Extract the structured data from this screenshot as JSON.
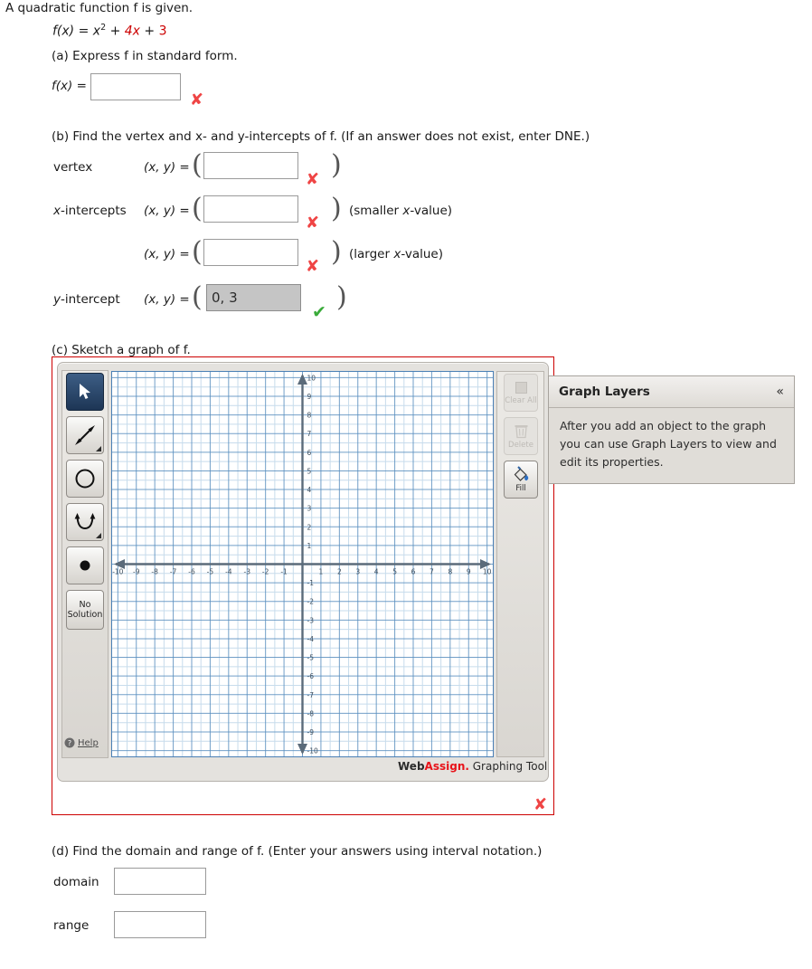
{
  "problem": {
    "intro": "A quadratic function f is given.",
    "function": {
      "lhs": "f(x) = ",
      "term1": "x",
      "exponent": "2",
      "plus1": " + ",
      "term2": "4x",
      "plus2": " + ",
      "term3": "3"
    }
  },
  "part_a": {
    "label": "(a) Express f in standard form.",
    "fx_label": "f(x) = ",
    "input_value": "",
    "mark": "✘"
  },
  "part_b": {
    "label": "(b) Find the vertex and x- and y-intercepts of f. (If an answer does not exist, enter DNE.)",
    "xy_equals": "(x, y) = ",
    "paren_open": "(",
    "paren_close": ")",
    "mark_wrong": "✘",
    "mark_correct": "✔",
    "rows": [
      {
        "label": "vertex",
        "value": "",
        "note": "",
        "status": "wrong"
      },
      {
        "label": "x-intercepts",
        "value": "",
        "note": "(smaller x-value)",
        "status": "wrong"
      },
      {
        "label": "",
        "value": "",
        "note": "(larger x-value)",
        "status": "wrong"
      },
      {
        "label": "y-intercept",
        "value": "0, 3",
        "note": "",
        "status": "correct"
      }
    ]
  },
  "part_c": {
    "label": "(c) Sketch a graph of f.",
    "mark": "✘",
    "graphing_tool": {
      "left_tools": [
        {
          "name": "select-tool",
          "label": "",
          "selected": true
        },
        {
          "name": "line-tool",
          "label": "",
          "selected": false
        },
        {
          "name": "circle-tool",
          "label": "",
          "selected": false
        },
        {
          "name": "parabola-tool",
          "label": "",
          "selected": false
        },
        {
          "name": "point-tool",
          "label": "",
          "selected": false
        },
        {
          "name": "no-solution-tool",
          "label_line1": "No",
          "label_line2": "Solution",
          "selected": false
        }
      ],
      "help_label": "Help",
      "right_tools": [
        {
          "name": "clear-all-button",
          "label": "Clear All",
          "disabled": true
        },
        {
          "name": "delete-button",
          "label": "Delete",
          "disabled": true
        },
        {
          "name": "fill-button",
          "label": "Fill",
          "disabled": false
        }
      ],
      "footer": {
        "web": "Web",
        "assign": "Assign.",
        "rest": " Graphing Tool"
      },
      "layers_panel": {
        "title": "Graph Layers",
        "collapse_icon": "«",
        "body": "After you add an object to the graph you can use Graph Layers to view and edit its properties."
      }
    }
  },
  "chart_data": {
    "type": "scatter",
    "title": "",
    "xlabel": "",
    "ylabel": "",
    "xlim": [
      -10,
      10
    ],
    "ylim": [
      -10,
      10
    ],
    "grid": true,
    "x_ticks": [
      -10,
      -9,
      -8,
      -7,
      -6,
      -5,
      -4,
      -3,
      -2,
      -1,
      1,
      2,
      3,
      4,
      5,
      6,
      7,
      8,
      9,
      10
    ],
    "y_ticks": [
      10,
      9,
      8,
      7,
      6,
      5,
      4,
      3,
      2,
      1,
      -1,
      -2,
      -3,
      -4,
      -5,
      -6,
      -7,
      -8,
      -9,
      -10
    ],
    "series": [],
    "legend": "none"
  },
  "part_d": {
    "label": "(d) Find the domain and range of f. (Enter your answers using interval notation.)",
    "domain_label": "domain",
    "domain_value": "",
    "range_label": "range",
    "range_value": ""
  },
  "colors": {
    "accent_red": "#cc0000",
    "mark_wrong": "#ef4444",
    "mark_correct": "#3aab3a",
    "grid_major": "#5a8fbf",
    "grid_minor": "#c7dcec",
    "axis": "#5b6b7a",
    "webassign_red": "#e8131a",
    "tool_selected": "#1d3655"
  }
}
